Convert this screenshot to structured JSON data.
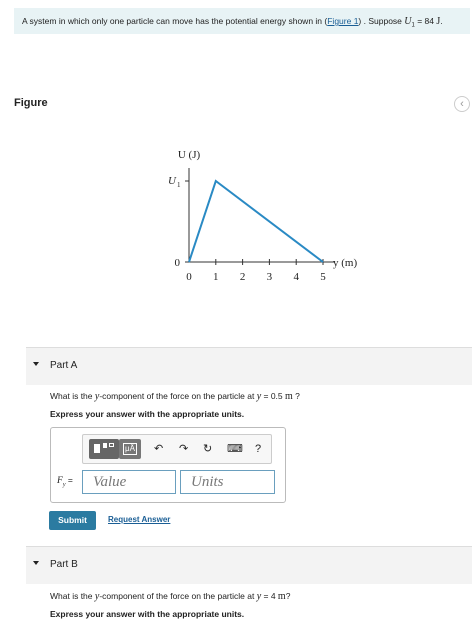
{
  "intro": {
    "prefix": "A system in which only one particle can move has the potential energy shown in (",
    "link": "Figure 1",
    "suffix": ") . Suppose ",
    "var": "U",
    "sub": "1",
    "eq": " = 84 ",
    "unit": "J",
    "end": "."
  },
  "figure": {
    "label": "Figure",
    "nav_icon": "chevron-left-icon"
  },
  "chart_data": {
    "type": "line",
    "ylabel": "U (J)",
    "xlabel": "y (m)",
    "y_tick_labels": [
      "0",
      "U1"
    ],
    "x_ticks": [
      0,
      1,
      2,
      3,
      4,
      5
    ],
    "x": [
      0,
      1,
      5
    ],
    "y": [
      "0",
      "U1",
      "0"
    ],
    "xlim": [
      0,
      5
    ],
    "grid": false,
    "color": "#2a8ac4"
  },
  "partA": {
    "label": "Part A",
    "question_pre": "What is the ",
    "question_var": "y",
    "question_mid": "-component of the force on the particle at ",
    "question_eq_var": "y",
    "question_eq": " = 0.5 ",
    "question_unit": "m",
    "question_end": " ?",
    "instruction": "Express your answer with the appropriate units.",
    "var_label": "F",
    "var_sub": "y",
    "eq_sign": " =",
    "value_placeholder": "Value",
    "units_placeholder": "Units",
    "submit": "Submit",
    "request": "Request Answer",
    "toolbar": {
      "templates_icon": "templates-icon",
      "units_btn": "μÅ",
      "undo": "↶",
      "redo": "↷",
      "reset": "↻",
      "keyboard": "⌨",
      "help": "?"
    }
  },
  "partB": {
    "label": "Part B",
    "question_pre": "What is the ",
    "question_var": "y",
    "question_mid": "-component of the force on the particle at ",
    "question_eq_var": "y",
    "question_eq": " = 4 ",
    "question_unit": "m",
    "question_end": "?",
    "instruction": "Express your answer with the appropriate units."
  }
}
